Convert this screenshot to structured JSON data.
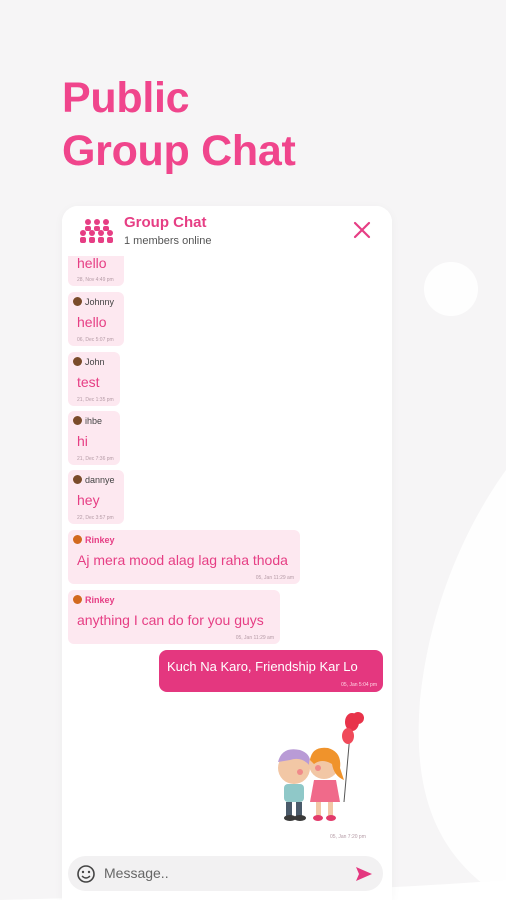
{
  "hero": {
    "line1": "Public",
    "line2": "Group Chat"
  },
  "header": {
    "title": "Group Chat",
    "subtitle": "1 members online"
  },
  "messages": [
    {
      "name": "",
      "text": "hello",
      "time": "28, Nov 4:49 pm"
    },
    {
      "name": "Johnny",
      "text": "hello",
      "time": "06, Dec 5:07 pm"
    },
    {
      "name": "John",
      "text": "test",
      "time": "21, Dec 1:35 pm"
    },
    {
      "name": "ihbe",
      "text": "hi",
      "time": "21, Dec 7:36 pm"
    },
    {
      "name": "dannye",
      "text": "hey",
      "time": "22, Dec 3:57 pm"
    },
    {
      "name": "Rinkey",
      "text": "Aj mera mood alag lag raha thoda",
      "time": "05, Jan 11:29 am"
    },
    {
      "name": "Rinkey",
      "text": "anything I can do for you guys",
      "time": "05, Jan 11:29 am"
    }
  ],
  "sent": {
    "text": "Kuch Na Karo, Friendship Kar Lo",
    "time": "05, Jan 5:04 pm"
  },
  "sticker": {
    "time": "05, Jan 7:20 pm"
  },
  "input": {
    "placeholder": "Message.."
  },
  "colors": {
    "accent": "#e4377f",
    "bubble": "#fde8f0",
    "hero": "#f0458c"
  }
}
